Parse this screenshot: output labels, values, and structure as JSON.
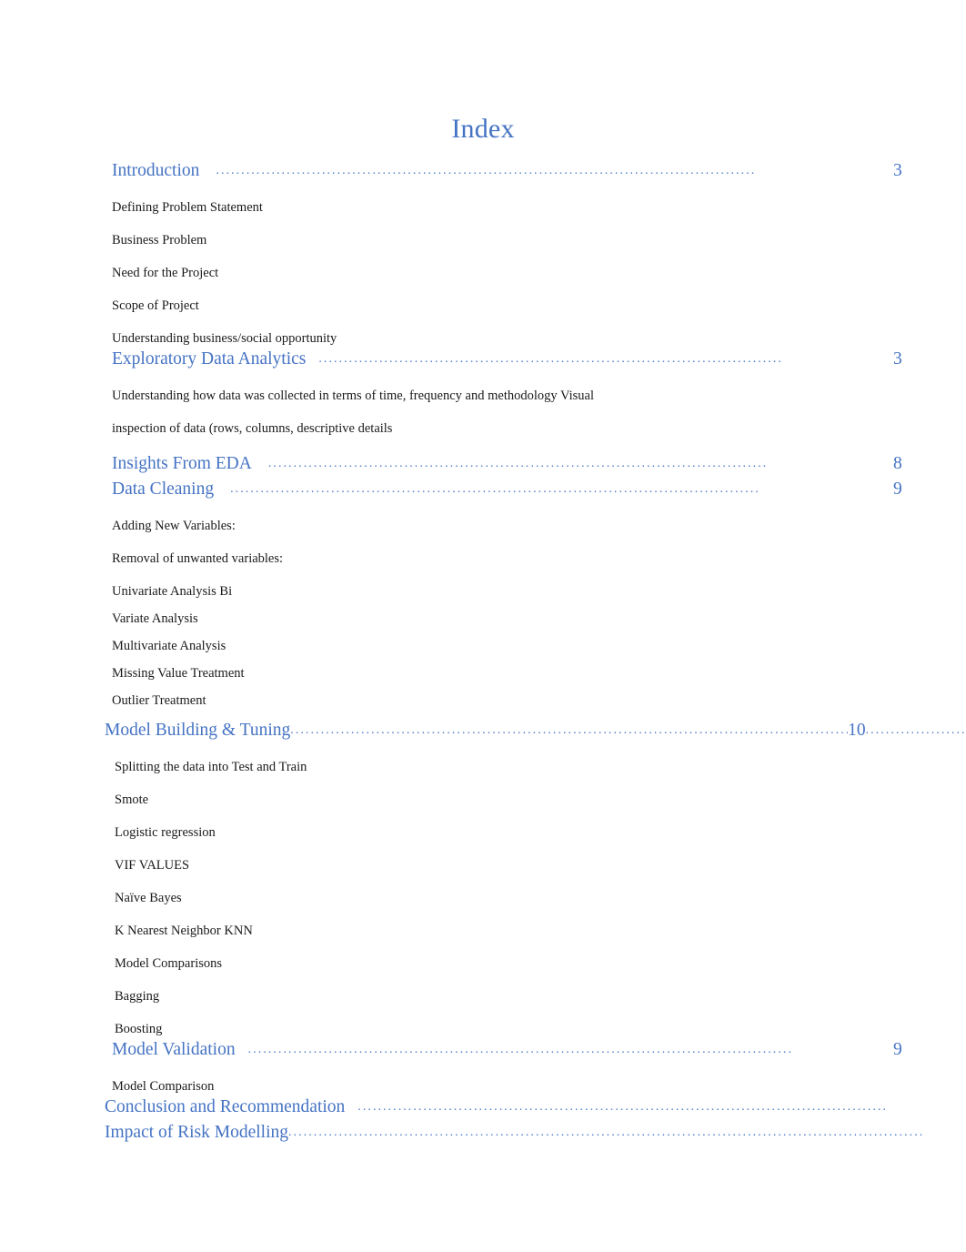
{
  "document": {
    "title": "Index",
    "accent_color": "#4573c4",
    "body_text_color": "#1a1a1a",
    "background_color": "#ffffff"
  },
  "toc": {
    "entries": [
      {
        "label": "Introduction",
        "page": "3",
        "leader": "..........................................................................................................."
      },
      {
        "label": "Exploratory Data Analytics",
        "page": "3",
        "leader": "............................................................................................"
      },
      {
        "label": "Insights From EDA",
        "page": "8",
        "leader": "..................................................................................................."
      },
      {
        "label": "Data Cleaning",
        "page": "9",
        "leader": "........................................................................................................."
      },
      {
        "label": "Model Building & Tuning",
        "page": "10",
        "leader_before": "...............................................................................................................",
        "leader_after": "...................."
      },
      {
        "label": "Model Validation",
        "page": "9",
        "leader": "............................................................................................................"
      },
      {
        "label": "Conclusion and Recommendation",
        "page": "",
        "leader": "........................................................................................................."
      },
      {
        "label": "Impact of Risk Modelling",
        "page": "",
        "leader": ".............................................................................................................................."
      }
    ],
    "sub_items": {
      "introduction": [
        "Defining Problem Statement",
        "Business Problem",
        "Need for the Project",
        "Scope of Project",
        "Understanding business/social opportunity"
      ],
      "exploratory_data_analytics": [
        "Understanding how data was collected in terms of time, frequency and methodology Visual",
        "inspection of data (rows, columns, descriptive details"
      ],
      "data_cleaning": [
        "Adding New Variables:",
        "Removal of unwanted variables:",
        "Univariate Analysis Bi",
        "Variate Analysis",
        "Multivariate Analysis",
        "Missing Value Treatment",
        "Outlier Treatment"
      ],
      "model_building_tuning": [
        "Splitting the data into Test and Train",
        "Smote",
        "Logistic regression",
        "VIF VALUES",
        "Naïve Bayes",
        "K Nearest Neighbor KNN",
        "Model Comparisons",
        "Bagging",
        "Boosting"
      ],
      "model_validation": [
        "Model Comparison"
      ]
    }
  }
}
